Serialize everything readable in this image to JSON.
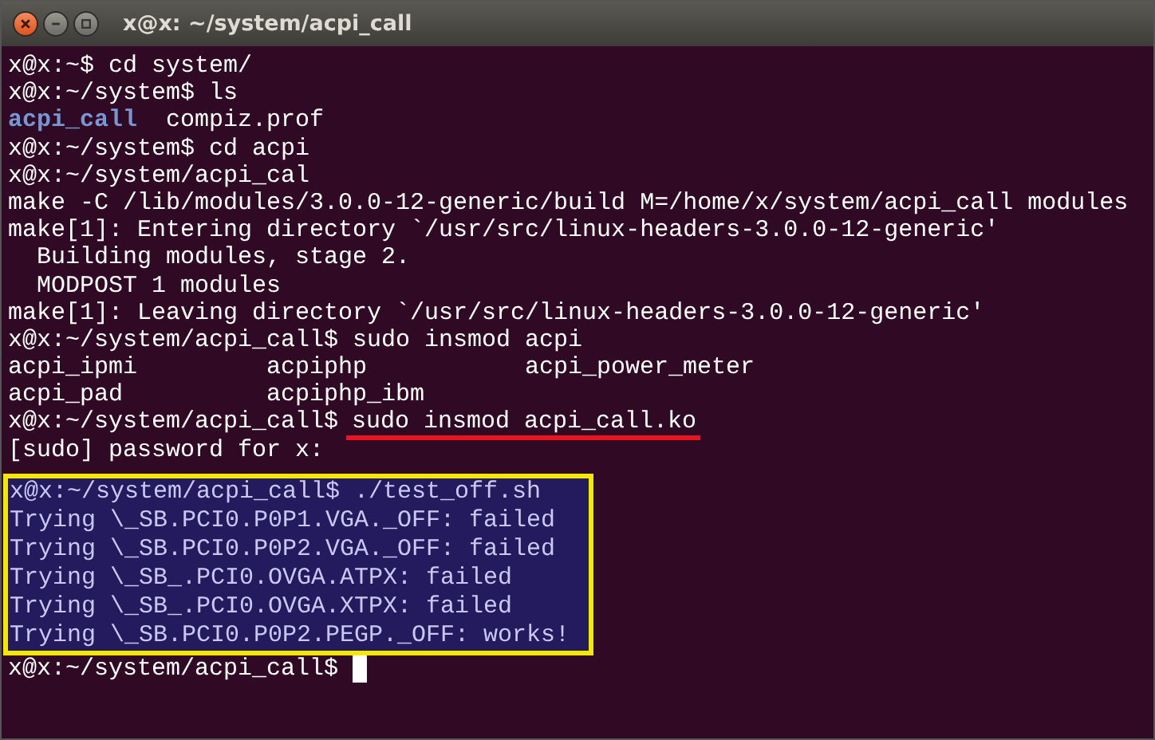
{
  "window": {
    "title": "x@x: ~/system/acpi_call"
  },
  "lines": [
    {
      "kind": "text",
      "text": "x@x:~$ cd system/"
    },
    {
      "kind": "text",
      "text": "x@x:~/system$ ls"
    },
    {
      "kind": "listing",
      "items": [
        {
          "text": "acpi_call",
          "directory": true
        },
        {
          "text": "compiz.prof",
          "directory": false
        }
      ]
    },
    {
      "kind": "text",
      "text": "x@x:~/system$ cd acpi"
    },
    {
      "kind": "text",
      "text": "x@x:~/system/acpi_cal"
    },
    {
      "kind": "text",
      "text": "make -C /lib/modules/3.0.0-12-generic/build M=/home/x/system/acpi_call modules"
    },
    {
      "kind": "text",
      "text": "make[1]: Entering directory `/usr/src/linux-headers-3.0.0-12-generic'"
    },
    {
      "kind": "text",
      "text": "  Building modules, stage 2."
    },
    {
      "kind": "text",
      "text": "  MODPOST 1 modules"
    },
    {
      "kind": "text",
      "text": "make[1]: Leaving directory `/usr/src/linux-headers-3.0.0-12-generic'"
    },
    {
      "kind": "text",
      "text": "x@x:~/system/acpi_call$ sudo insmod acpi"
    },
    {
      "kind": "columns",
      "items": [
        {
          "text": "acpi_ipmi",
          "directory": false
        },
        {
          "text": "acpiphp",
          "directory": false
        },
        {
          "text": "acpi_power_meter",
          "directory": false
        }
      ]
    },
    {
      "kind": "columns",
      "items": [
        {
          "text": "acpi_pad",
          "directory": false
        },
        {
          "text": "acpiphp_ibm",
          "directory": false
        }
      ]
    },
    {
      "kind": "underlined",
      "prompt": "x@x:~/system/acpi_call$",
      "command": "sudo insmod acpi_call.ko"
    },
    {
      "kind": "text",
      "text": "[sudo] password for x:"
    }
  ],
  "highlighted_block": {
    "lines": [
      "x@x:~/system/acpi_call$ ./test_off.sh",
      "Trying \\_SB.PCI0.P0P1.VGA._OFF: failed",
      "Trying \\_SB.PCI0.P0P2.VGA._OFF: failed",
      "Trying \\_SB_.PCI0.OVGA.ATPX: failed",
      "Trying \\_SB_.PCI0.OVGA.XTPX: failed",
      "Trying \\_SB.PCI0.P0P2.PEGP._OFF: works!"
    ]
  },
  "final_prompt": {
    "text": "x@x:~/system/acpi_call$",
    "cursor": true
  }
}
